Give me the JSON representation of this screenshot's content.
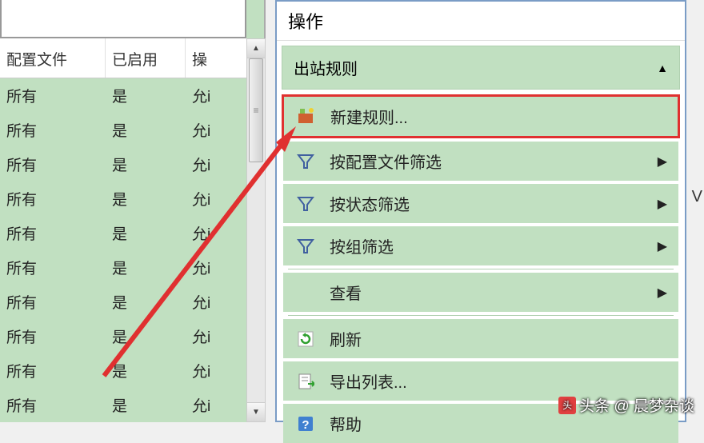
{
  "left": {
    "headers": {
      "profile": "配置文件",
      "enabled": "已启用",
      "action": "操"
    },
    "rows": [
      {
        "profile": "所有",
        "enabled": "是",
        "action": "允i"
      },
      {
        "profile": "所有",
        "enabled": "是",
        "action": "允i"
      },
      {
        "profile": "所有",
        "enabled": "是",
        "action": "允i"
      },
      {
        "profile": "所有",
        "enabled": "是",
        "action": "允i"
      },
      {
        "profile": "所有",
        "enabled": "是",
        "action": "允i"
      },
      {
        "profile": "所有",
        "enabled": "是",
        "action": "允i"
      },
      {
        "profile": "所有",
        "enabled": "是",
        "action": "允i"
      },
      {
        "profile": "所有",
        "enabled": "是",
        "action": "允i"
      },
      {
        "profile": "所有",
        "enabled": "是",
        "action": "允i"
      },
      {
        "profile": "所有",
        "enabled": "是",
        "action": "允i"
      }
    ]
  },
  "right": {
    "title": "操作",
    "section": "出站规则",
    "items": {
      "new_rule": "新建规则...",
      "filter_profile": "按配置文件筛选",
      "filter_state": "按状态筛选",
      "filter_group": "按组筛选",
      "view": "查看",
      "refresh": "刷新",
      "export": "导出列表...",
      "help": "帮助"
    }
  },
  "watermark": "头条 @ 晨梦杂谈",
  "side_char": "V"
}
